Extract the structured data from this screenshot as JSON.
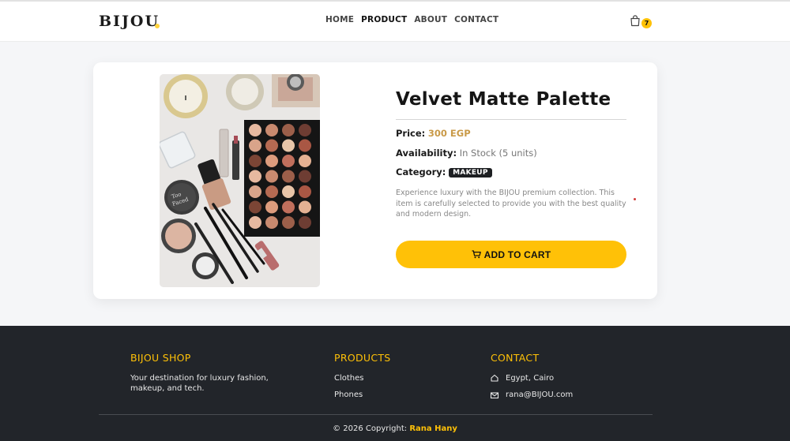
{
  "header": {
    "logo": "BIJOU",
    "nav": [
      "HOME",
      "PRODUCT",
      "ABOUT",
      "CONTACT"
    ],
    "active_nav": "PRODUCT",
    "cart_count": "7",
    "cart_icon": "shopping-bag-icon"
  },
  "product": {
    "title": "Velvet Matte Palette",
    "price_label": "Price:",
    "price_value": "300 EGP",
    "availability_label": "Availability:",
    "availability_value": "In Stock (5 units)",
    "category_label": "Category:",
    "category_value": "MAKEUP",
    "description": "Experience luxury with the BIJOU premium collection. This item is carefully selected to provide you with the best quality and modern design.",
    "add_to_cart_label": "ADD TO CART",
    "add_to_cart_icon": "cart-icon"
  },
  "footer": {
    "shop_heading": "BIJOU SHOP",
    "shop_text": "Your destination for luxury fashion, makeup, and tech.",
    "products_heading": "PRODUCTS",
    "products_links": [
      "Clothes",
      "Phones"
    ],
    "contact_heading": "CONTACT",
    "contact_location": "Egypt, Cairo",
    "contact_email": "rana@BIJOU.com",
    "copyright_prefix": "© 2026 Copyright:",
    "copyright_author": "Rana Hany"
  },
  "colors": {
    "accent": "#ffc107",
    "price": "#c99a48",
    "footer_bg": "#22252a",
    "badge_bg": "#1d1f22"
  }
}
